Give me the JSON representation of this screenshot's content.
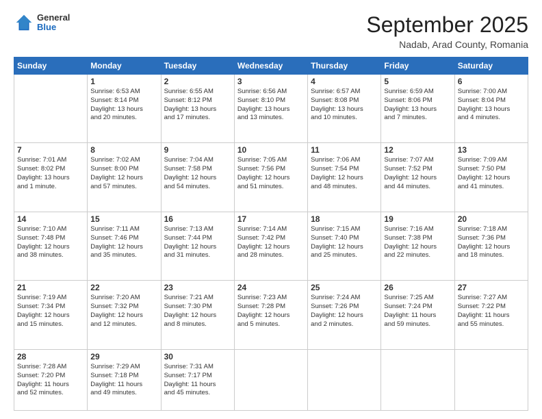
{
  "header": {
    "logo": {
      "general": "General",
      "blue": "Blue"
    },
    "title": "September 2025",
    "location": "Nadab, Arad County, Romania"
  },
  "weekdays": [
    "Sunday",
    "Monday",
    "Tuesday",
    "Wednesday",
    "Thursday",
    "Friday",
    "Saturday"
  ],
  "weeks": [
    [
      {
        "day": "",
        "info": ""
      },
      {
        "day": "1",
        "info": "Sunrise: 6:53 AM\nSunset: 8:14 PM\nDaylight: 13 hours\nand 20 minutes."
      },
      {
        "day": "2",
        "info": "Sunrise: 6:55 AM\nSunset: 8:12 PM\nDaylight: 13 hours\nand 17 minutes."
      },
      {
        "day": "3",
        "info": "Sunrise: 6:56 AM\nSunset: 8:10 PM\nDaylight: 13 hours\nand 13 minutes."
      },
      {
        "day": "4",
        "info": "Sunrise: 6:57 AM\nSunset: 8:08 PM\nDaylight: 13 hours\nand 10 minutes."
      },
      {
        "day": "5",
        "info": "Sunrise: 6:59 AM\nSunset: 8:06 PM\nDaylight: 13 hours\nand 7 minutes."
      },
      {
        "day": "6",
        "info": "Sunrise: 7:00 AM\nSunset: 8:04 PM\nDaylight: 13 hours\nand 4 minutes."
      }
    ],
    [
      {
        "day": "7",
        "info": "Sunrise: 7:01 AM\nSunset: 8:02 PM\nDaylight: 13 hours\nand 1 minute."
      },
      {
        "day": "8",
        "info": "Sunrise: 7:02 AM\nSunset: 8:00 PM\nDaylight: 12 hours\nand 57 minutes."
      },
      {
        "day": "9",
        "info": "Sunrise: 7:04 AM\nSunset: 7:58 PM\nDaylight: 12 hours\nand 54 minutes."
      },
      {
        "day": "10",
        "info": "Sunrise: 7:05 AM\nSunset: 7:56 PM\nDaylight: 12 hours\nand 51 minutes."
      },
      {
        "day": "11",
        "info": "Sunrise: 7:06 AM\nSunset: 7:54 PM\nDaylight: 12 hours\nand 48 minutes."
      },
      {
        "day": "12",
        "info": "Sunrise: 7:07 AM\nSunset: 7:52 PM\nDaylight: 12 hours\nand 44 minutes."
      },
      {
        "day": "13",
        "info": "Sunrise: 7:09 AM\nSunset: 7:50 PM\nDaylight: 12 hours\nand 41 minutes."
      }
    ],
    [
      {
        "day": "14",
        "info": "Sunrise: 7:10 AM\nSunset: 7:48 PM\nDaylight: 12 hours\nand 38 minutes."
      },
      {
        "day": "15",
        "info": "Sunrise: 7:11 AM\nSunset: 7:46 PM\nDaylight: 12 hours\nand 35 minutes."
      },
      {
        "day": "16",
        "info": "Sunrise: 7:13 AM\nSunset: 7:44 PM\nDaylight: 12 hours\nand 31 minutes."
      },
      {
        "day": "17",
        "info": "Sunrise: 7:14 AM\nSunset: 7:42 PM\nDaylight: 12 hours\nand 28 minutes."
      },
      {
        "day": "18",
        "info": "Sunrise: 7:15 AM\nSunset: 7:40 PM\nDaylight: 12 hours\nand 25 minutes."
      },
      {
        "day": "19",
        "info": "Sunrise: 7:16 AM\nSunset: 7:38 PM\nDaylight: 12 hours\nand 22 minutes."
      },
      {
        "day": "20",
        "info": "Sunrise: 7:18 AM\nSunset: 7:36 PM\nDaylight: 12 hours\nand 18 minutes."
      }
    ],
    [
      {
        "day": "21",
        "info": "Sunrise: 7:19 AM\nSunset: 7:34 PM\nDaylight: 12 hours\nand 15 minutes."
      },
      {
        "day": "22",
        "info": "Sunrise: 7:20 AM\nSunset: 7:32 PM\nDaylight: 12 hours\nand 12 minutes."
      },
      {
        "day": "23",
        "info": "Sunrise: 7:21 AM\nSunset: 7:30 PM\nDaylight: 12 hours\nand 8 minutes."
      },
      {
        "day": "24",
        "info": "Sunrise: 7:23 AM\nSunset: 7:28 PM\nDaylight: 12 hours\nand 5 minutes."
      },
      {
        "day": "25",
        "info": "Sunrise: 7:24 AM\nSunset: 7:26 PM\nDaylight: 12 hours\nand 2 minutes."
      },
      {
        "day": "26",
        "info": "Sunrise: 7:25 AM\nSunset: 7:24 PM\nDaylight: 11 hours\nand 59 minutes."
      },
      {
        "day": "27",
        "info": "Sunrise: 7:27 AM\nSunset: 7:22 PM\nDaylight: 11 hours\nand 55 minutes."
      }
    ],
    [
      {
        "day": "28",
        "info": "Sunrise: 7:28 AM\nSunset: 7:20 PM\nDaylight: 11 hours\nand 52 minutes."
      },
      {
        "day": "29",
        "info": "Sunrise: 7:29 AM\nSunset: 7:18 PM\nDaylight: 11 hours\nand 49 minutes."
      },
      {
        "day": "30",
        "info": "Sunrise: 7:31 AM\nSunset: 7:17 PM\nDaylight: 11 hours\nand 45 minutes."
      },
      {
        "day": "",
        "info": ""
      },
      {
        "day": "",
        "info": ""
      },
      {
        "day": "",
        "info": ""
      },
      {
        "day": "",
        "info": ""
      }
    ]
  ]
}
